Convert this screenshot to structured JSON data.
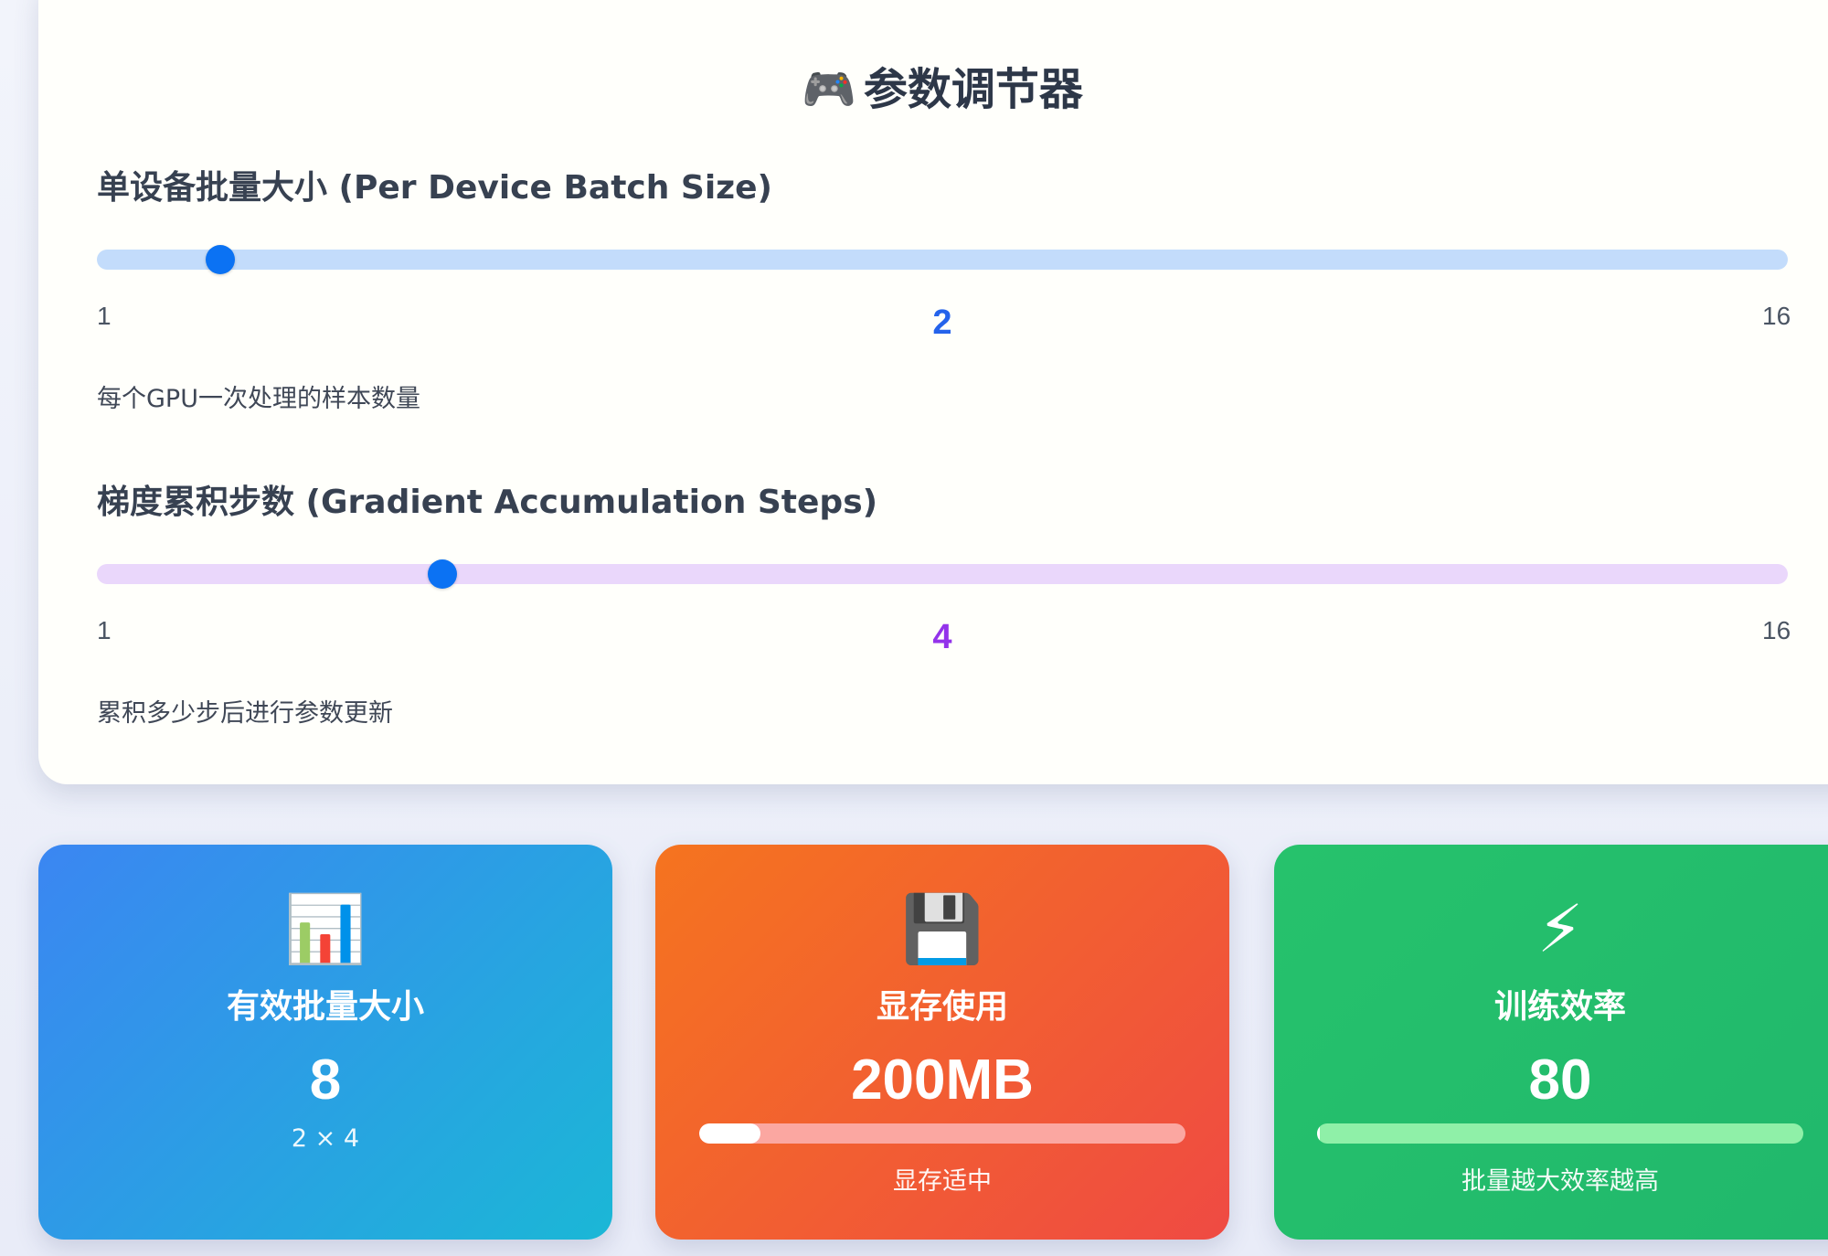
{
  "panel": {
    "title_icon": "🎮",
    "title": "参数调节器"
  },
  "batch_size": {
    "label": "单设备批量大小 (Per Device Batch Size)",
    "min": 1,
    "max": 16,
    "min_label": "1",
    "max_label": "16",
    "value": 2,
    "value_label": "2",
    "description": "每个GPU一次处理的样本数量",
    "track_color": "#c3dcfb",
    "thumb_color": "#0b72f3",
    "value_color": "#2563eb"
  },
  "grad_accum": {
    "label": "梯度累积步数 (Gradient Accumulation Steps)",
    "min": 1,
    "max": 16,
    "min_label": "1",
    "max_label": "16",
    "value": 4,
    "value_label": "4",
    "description": "累积多少步后进行参数更新",
    "track_color": "#ead7fb",
    "thumb_color": "#0b72f3",
    "value_color": "#9333ea"
  },
  "cards": {
    "effective_batch": {
      "icon": "📊",
      "icon_name": "bar-chart-icon",
      "title": "有效批量大小",
      "value": "8",
      "formula": "2 × 4"
    },
    "memory": {
      "icon": "💾",
      "icon_name": "floppy-disk-icon",
      "title": "显存使用",
      "value": "200MB",
      "usage_fraction": 0.125,
      "status": "显存适中"
    },
    "efficiency": {
      "icon": "⚡",
      "icon_name": "lightning-icon",
      "title": "训练效率",
      "value": "80",
      "progress_fraction": 0.0,
      "note": "批量越大效率越高"
    }
  }
}
